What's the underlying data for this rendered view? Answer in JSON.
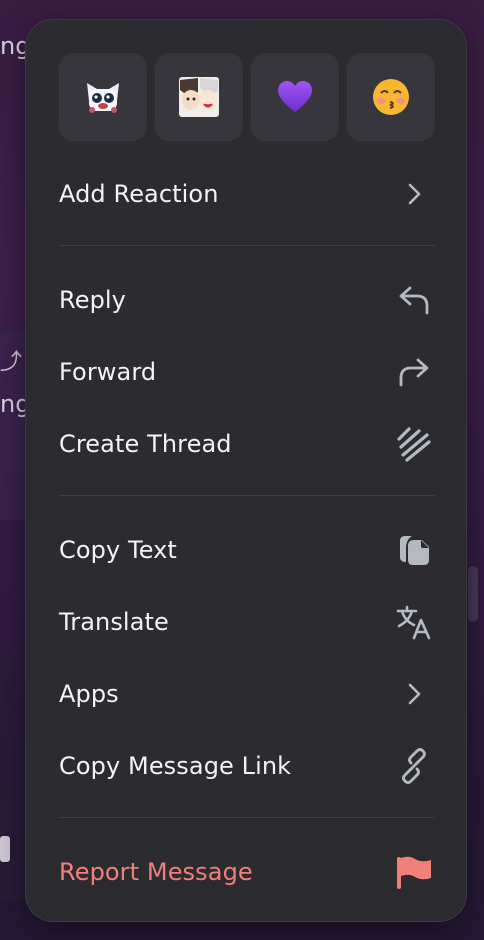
{
  "background": {
    "fragments": [
      "ng",
      "ng"
    ]
  },
  "quick_reactions": [
    {
      "name": "wolf-sticker-emoji"
    },
    {
      "name": "anime-pair-emoji"
    },
    {
      "name": "purple-heart-emoji"
    },
    {
      "name": "kissing-face-emoji"
    }
  ],
  "menu": {
    "add_reaction": "Add Reaction",
    "reply": "Reply",
    "forward": "Forward",
    "create_thread": "Create Thread",
    "copy_text": "Copy Text",
    "translate": "Translate",
    "apps": "Apps",
    "copy_message_link": "Copy Message Link",
    "report_message": "Report Message"
  },
  "colors": {
    "menu_bg": "#2b2b30",
    "tile_bg": "#36363c",
    "danger": "#f0807a",
    "icon": "#b5bac1"
  }
}
